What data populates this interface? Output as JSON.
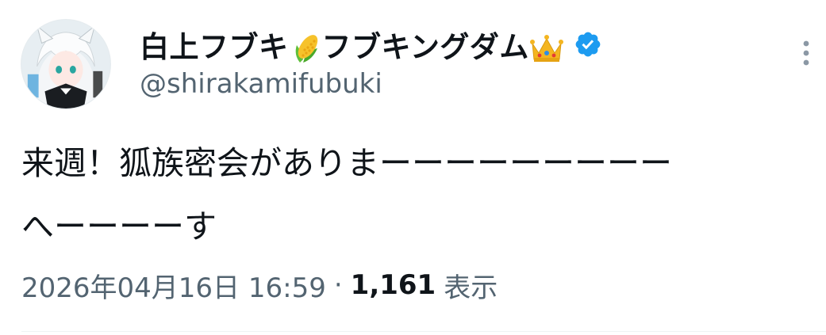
{
  "user": {
    "display_name": "白上フブキ🌽フブキングダム👑",
    "display_name_parts": [
      "白上フブキ",
      "フブキングダム"
    ],
    "handle": "@shirakamifubuki",
    "verified": true,
    "verified_color": "#1d9bf0",
    "emoji_icons": [
      "corn-icon",
      "crown-icon"
    ]
  },
  "tweet": {
    "text": "来週！狐族密会がありまーーーーーーーーー\nへーーーーす"
  },
  "meta": {
    "date": "2026年04月16日",
    "time": "16:59",
    "separator": "·",
    "views_count": "1,161",
    "views_label": "表示"
  },
  "icons": {
    "more": "more-vertical-icon",
    "verified": "verified-badge-icon",
    "avatar": "avatar-image"
  },
  "colors": {
    "text_primary": "#0f1419",
    "text_secondary": "#536471",
    "accent": "#1d9bf0",
    "divider": "#eff3f4"
  }
}
